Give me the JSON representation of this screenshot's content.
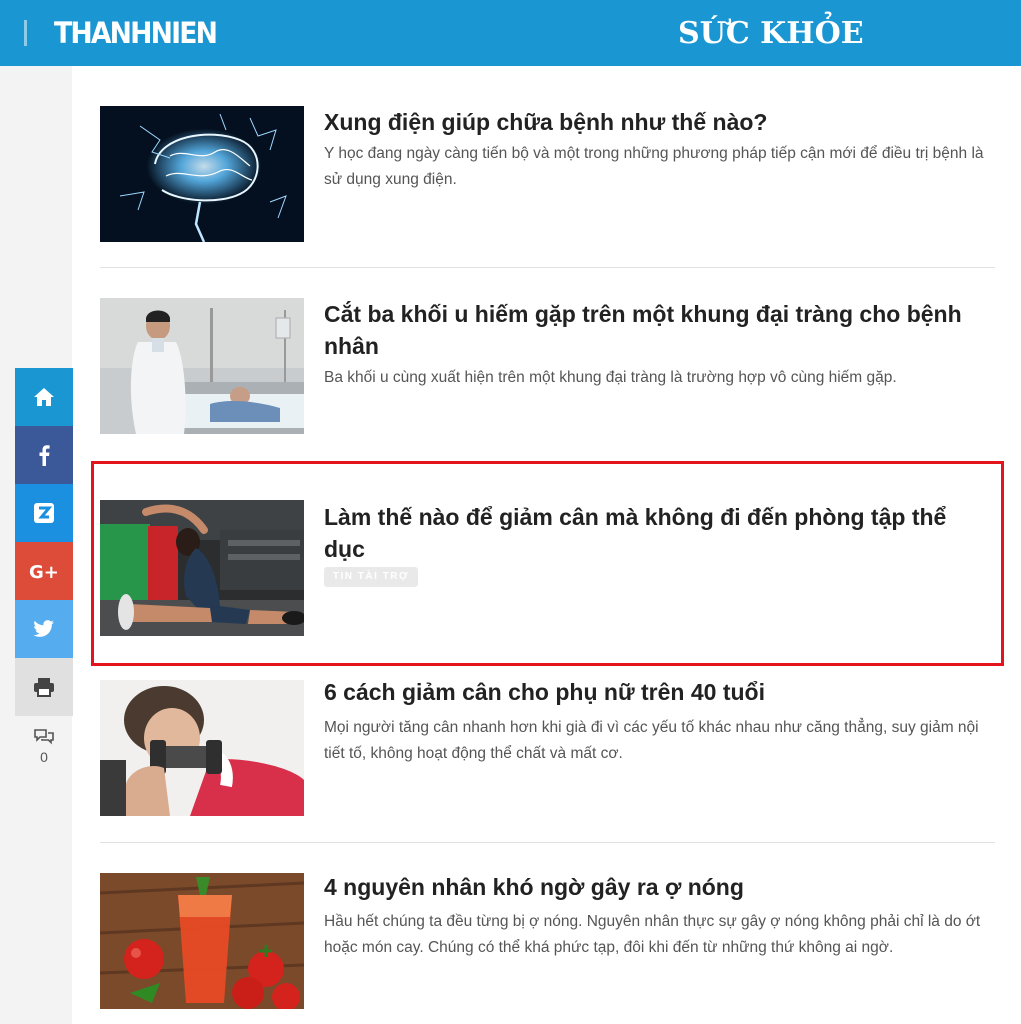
{
  "header": {
    "logo": "THANHNIEN",
    "section": "SỨC KHỎE",
    "color": "#1a97d2"
  },
  "share": {
    "items": [
      {
        "name": "home-icon",
        "color": "#1a97d2"
      },
      {
        "name": "facebook-icon",
        "color": "#3b5998"
      },
      {
        "name": "zalo-icon",
        "color": "#1b8fe0"
      },
      {
        "name": "google-plus-icon",
        "color": "#dd4b39"
      },
      {
        "name": "twitter-icon",
        "color": "#55acee"
      },
      {
        "name": "print-icon",
        "color": "#e0e0e0"
      }
    ],
    "comment_count": "0"
  },
  "articles": [
    {
      "title": "Xung điện giúp chữa bệnh như thế nào?",
      "desc": "Y học đang ngày càng tiến bộ và một trong những phương pháp tiếp cận mới để điều trị bệnh là sử dụng xung điện."
    },
    {
      "title": "Cắt ba khối u hiếm gặp trên một khung đại tràng cho bệnh nhân",
      "desc": "Ba khối u cùng xuất hiện trên một khung đại tràng là trường hợp vô cùng hiếm gặp."
    },
    {
      "title": "Làm thế nào để giảm cân mà không đi đến phòng tập thể dục",
      "badge": "TIN TÀI TRỢ"
    },
    {
      "title": "6 cách giảm cân cho phụ nữ trên 40 tuổi",
      "desc": "Mọi người tăng cân nhanh hơn khi già đi vì các yếu tố khác nhau như căng thẳng, suy giảm nội tiết tố, không hoạt động thể chất và mất cơ."
    },
    {
      "title": "4 nguyên nhân khó ngờ gây ra ợ nóng",
      "desc": "Hầu hết chúng ta đều từng bị ợ nóng. Nguyên nhân thực sự gây ợ nóng không phải chỉ là do ớt hoặc món cay. Chúng có thể khá phức tạp, đôi khi đến từ những thứ không ai ngờ."
    }
  ],
  "highlight_color": "#e3141b"
}
